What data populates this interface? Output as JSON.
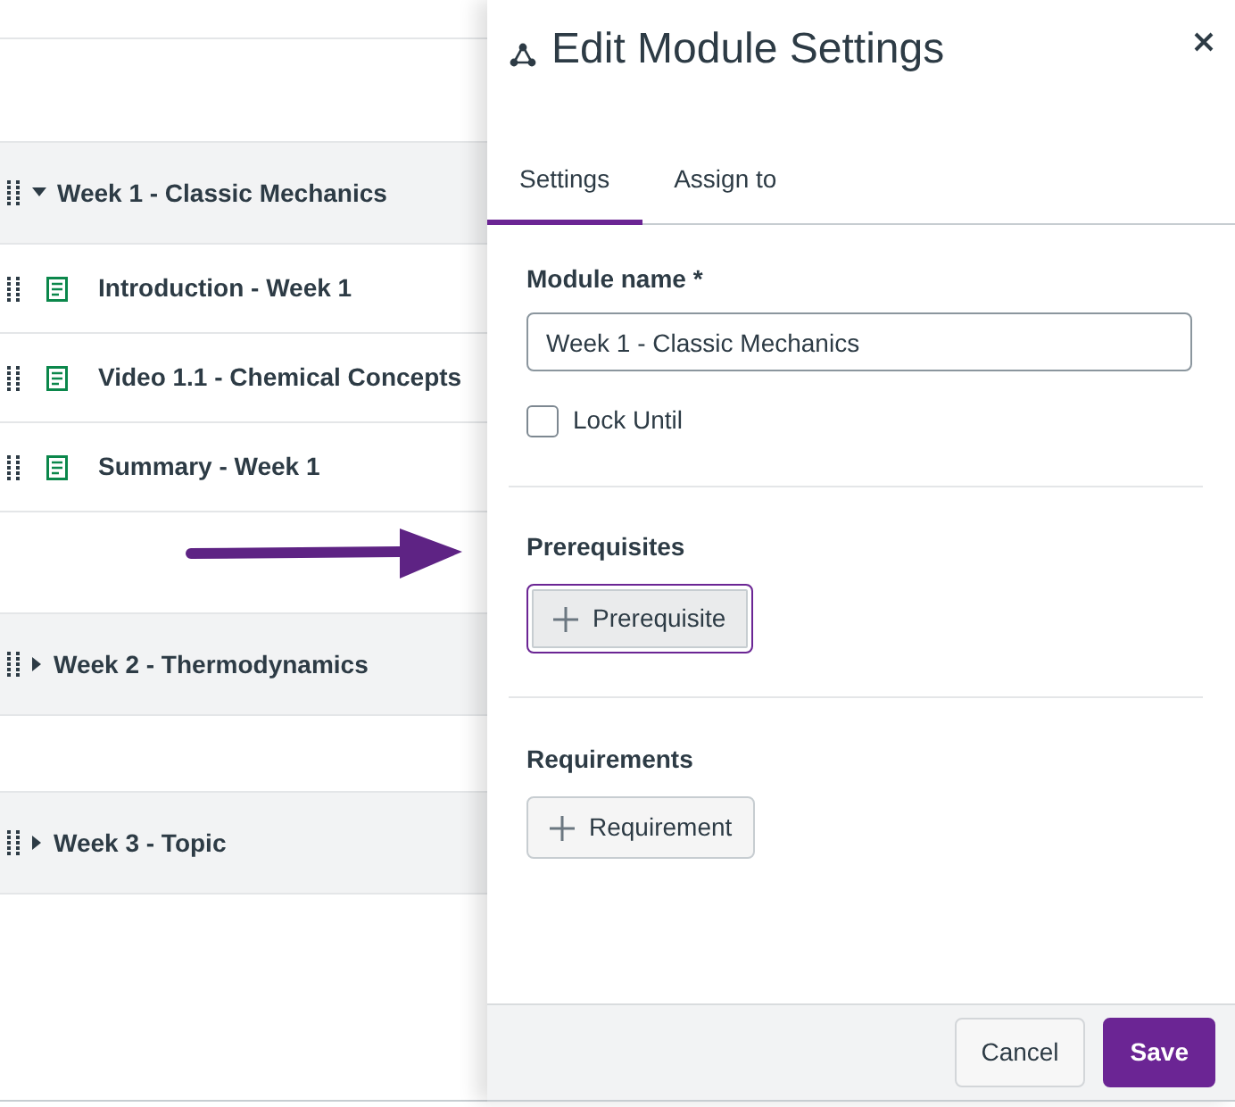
{
  "modules": [
    {
      "title": "Week 1 - Classic Mechanics",
      "expanded": true,
      "items": [
        {
          "title": "Introduction - Week 1"
        },
        {
          "title": "Video 1.1 - Chemical Concepts"
        },
        {
          "title": "Summary - Week 1"
        }
      ]
    },
    {
      "title": "Week 2 - Thermodynamics",
      "expanded": false
    },
    {
      "title": "Week 3 - Topic",
      "expanded": false
    }
  ],
  "dialog": {
    "title": "Edit Module Settings",
    "tabs": [
      {
        "label": "Settings",
        "selected": true
      },
      {
        "label": "Assign to",
        "selected": false
      }
    ],
    "module_name": {
      "label": "Module name *",
      "value": "Week 1 - Classic Mechanics"
    },
    "lock_until": {
      "label": "Lock Until",
      "checked": false
    },
    "prerequisites": {
      "heading": "Prerequisites",
      "button": "Prerequisite",
      "focused": true
    },
    "requirements": {
      "heading": "Requirements",
      "button": "Requirement",
      "focused": false
    },
    "buttons": [
      {
        "label": "Cancel",
        "kind": "secondary"
      },
      {
        "label": "Save",
        "kind": "primary"
      }
    ]
  }
}
